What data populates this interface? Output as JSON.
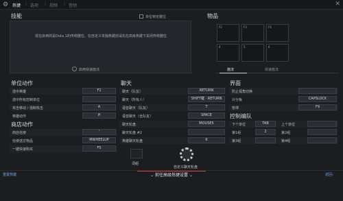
{
  "nav": {
    "tabs": [
      {
        "label": "热键",
        "active": true
      },
      {
        "label": "选项",
        "active": false
      },
      {
        "label": "视频",
        "active": false
      },
      {
        "label": "音频",
        "active": false
      }
    ]
  },
  "skills": {
    "title": "技能",
    "per_hero_label": "单位特定键位",
    "desc": "现在启用的是Dota 1的传统键位。在自定义单独热键前请先在高级热键下关闭传统键位",
    "quickcast_label": "启用快速施法"
  },
  "items": {
    "title": "物品",
    "slots": [
      "F2",
      "F3",
      "F4",
      "4",
      "5",
      "6"
    ],
    "tabs": [
      "施法",
      "快速施法"
    ]
  },
  "unit_actions": {
    "title": "单位动作",
    "rows": [
      {
        "label": "选中英雄",
        "key": "F1"
      },
      {
        "label": "选中所有控制单位",
        "key": ""
      },
      {
        "label": "攻击移动 / 强制攻击",
        "key": "A"
      },
      {
        "label": "英雄动作",
        "key": "H"
      }
    ]
  },
  "shop": {
    "title": "商店动作",
    "rows": [
      {
        "label": "商店信使",
        "key": "'"
      },
      {
        "label": "信使送达物品",
        "key": "MWHEELUP"
      },
      {
        "label": "一键快速购买",
        "key": "F5"
      }
    ]
  },
  "chat": {
    "title": "聊天",
    "rows": [
      {
        "label": "聊天（队友）",
        "key": "RETURN"
      },
      {
        "label": "聊天（所有人）",
        "key": "SHIFT键 · RETURN"
      },
      {
        "label": "语音聊天（队友）",
        "key": "T"
      },
      {
        "label": "语音聊天（全队友）",
        "key": "SPACE"
      },
      {
        "label": "聊天轮盘",
        "key": "MOUSE5"
      },
      {
        "label": "聊天轮盘 #2",
        "key": ""
      },
      {
        "label": "英雄聊天轮盘",
        "key": "K"
      }
    ]
  },
  "interface": {
    "title": "界面",
    "rows": [
      {
        "label": "防止视角切换",
        "key": ""
      },
      {
        "label": "计分板",
        "key": "CAPSLOCK"
      },
      {
        "label": "暂停",
        "key": "F9"
      }
    ]
  },
  "control_groups": {
    "title": "控制编队",
    "rows": [
      {
        "l1": "下个单位",
        "k1": "TAB",
        "l2": "上个单位",
        "k2": ""
      },
      {
        "l1": "第1组",
        "k1": "2",
        "l2": "第2组",
        "k2": ""
      },
      {
        "l1": "第3组",
        "k1": "",
        "l2": "第4组",
        "k2": ""
      }
    ]
  },
  "wheel": {
    "left_label": "词组",
    "right_label": "自定义聊天轮盘"
  },
  "bottom": {
    "reset_label": "重置热键",
    "advanced_label": "前往高级热键设置",
    "back_label": "返回"
  }
}
